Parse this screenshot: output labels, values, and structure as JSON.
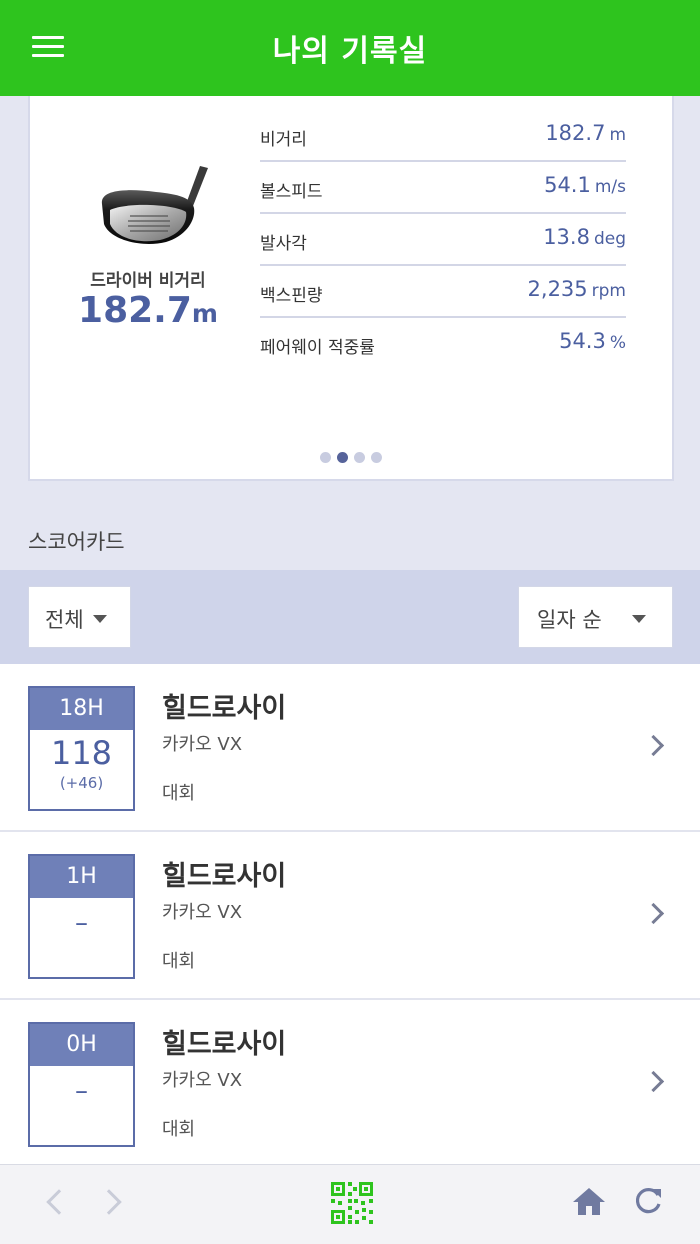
{
  "header": {
    "title": "나의 기록실",
    "menu_icon": "hamburger-menu-icon"
  },
  "driver_card": {
    "club_title": "드라이버 비거리",
    "club_value": "182.7",
    "club_unit": "m",
    "stats": [
      {
        "label": "비거리",
        "value": "182.7",
        "unit": "m"
      },
      {
        "label": "볼스피드",
        "value": "54.1",
        "unit": "m/s"
      },
      {
        "label": "발사각",
        "value": "13.8",
        "unit": "deg"
      },
      {
        "label": "백스핀량",
        "value": "2,235",
        "unit": "rpm"
      },
      {
        "label": "페어웨이 적중률",
        "value": "54.3",
        "unit": "%"
      }
    ],
    "pager": {
      "count": 4,
      "active_index": 1
    }
  },
  "scorecard": {
    "section_title": "스코어카드",
    "filter_left": "전체",
    "filter_right": "일자 순",
    "items": [
      {
        "holes": "18H",
        "score": "118",
        "diff": "(+46)",
        "name": "힐드로사이",
        "sub": "카카오 VX",
        "type": "대회"
      },
      {
        "holes": "1H",
        "score": "–",
        "diff": "",
        "name": "힐드로사이",
        "sub": "카카오 VX",
        "type": "대회"
      },
      {
        "holes": "0H",
        "score": "–",
        "diff": "",
        "name": "힐드로사이",
        "sub": "카카오 VX",
        "type": "대회"
      }
    ]
  },
  "bottom_bar": {
    "icons": [
      "back-arrow-icon",
      "forward-arrow-icon",
      "qr-code-icon",
      "home-icon",
      "refresh-icon"
    ]
  },
  "colors": {
    "header_green": "#2ec41e",
    "accent_blue": "#4b5fa0",
    "hole_header": "#6f80b8",
    "background": "#e4e6f2",
    "filter_bar": "#cfd4ea"
  }
}
